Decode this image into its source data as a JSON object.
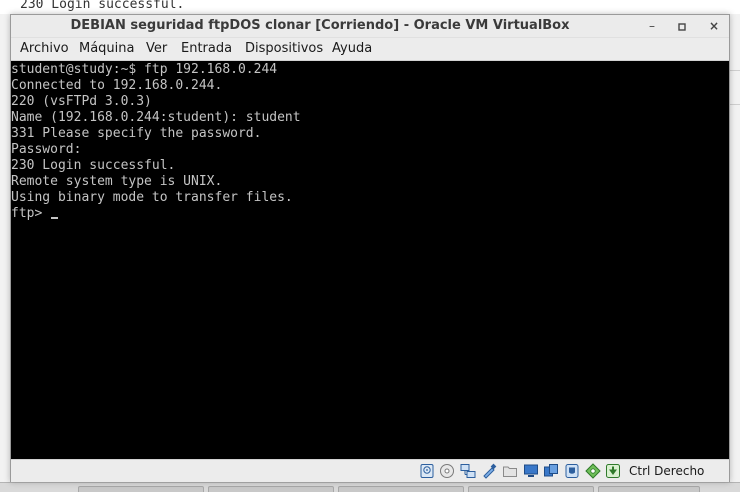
{
  "background": {
    "terminal_text": "230 Login successful."
  },
  "window": {
    "title": "DEBIAN seguridad ftpDOS clonar [Corriendo] - Oracle VM VirtualBox",
    "controls": {
      "minimize": "–",
      "maximize": "▫",
      "close": "×"
    }
  },
  "menu": {
    "items": [
      "Archivo",
      "Máquina",
      "Ver",
      "Entrada",
      "Dispositivos",
      "Ayuda"
    ]
  },
  "console": {
    "lines": [
      "student@study:~$ ftp 192.168.0.244",
      "Connected to 192.168.0.244.",
      "220 (vsFTPd 3.0.3)",
      "Name (192.168.0.244:student): student",
      "331 Please specify the password.",
      "Password:",
      "230 Login successful.",
      "Remote system type is UNIX.",
      "Using binary mode to transfer files."
    ],
    "prompt": "ftp> ",
    "text_color": "#c4c4c4",
    "background": "#000000"
  },
  "statusbar": {
    "icons": [
      "hard-disk-icon",
      "optical-drive-icon",
      "network-icon",
      "usb-icon",
      "shared-folders-icon",
      "display-icon",
      "video-capture-icon",
      "recording-icon",
      "cpu-icon",
      "mouse-integration-icon",
      "keyboard-capture-icon"
    ],
    "host_key_label": "Ctrl Derecho"
  }
}
